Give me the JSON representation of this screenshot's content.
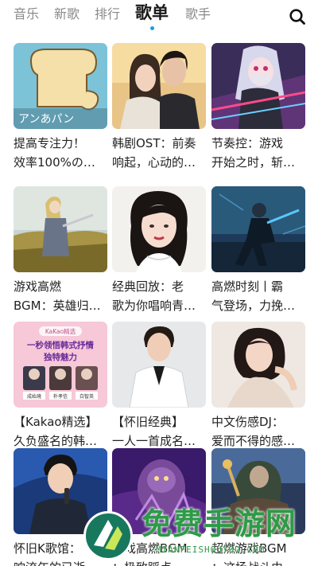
{
  "header": {
    "tabs": [
      {
        "label": "音乐",
        "active": false
      },
      {
        "label": "新歌",
        "active": false
      },
      {
        "label": "排行",
        "active": false
      },
      {
        "label": "歌单",
        "active": true
      },
      {
        "label": "歌手",
        "active": false
      }
    ],
    "search_icon": "search-icon",
    "accent_color": "#1e9de0"
  },
  "playlists": [
    {
      "title": "提高专注力！\n效率100%の…",
      "cover_text": "アンあパン"
    },
    {
      "title": "韩剧OST：前奏\n响起，心动的…"
    },
    {
      "title": "节奏控：游戏\n开始之时，斩…"
    },
    {
      "title": "游戏高燃\nBGM：英雄归…"
    },
    {
      "title": "经典回放：老\n歌为你唱响青…"
    },
    {
      "title": "高燃时刻丨霸\n气登场，力挽…"
    },
    {
      "title": "【Kakao精选】\n久负盛名的韩…",
      "cover_text": {
        "badge": "KaKao精选",
        "line1": "一秒领悟韩式抒情",
        "line2": "独特魅力",
        "names": [
          "成始璄",
          "朴孝信",
          "白智英"
        ]
      }
    },
    {
      "title": "【怀旧经典】\n一人一首成名…"
    },
    {
      "title": "中文伤感DJ：\n爱而不得的感…"
    },
    {
      "title": "怀旧K歌馆：\n响流年的已逝…"
    },
    {
      "title": "游戏高燃BGM\n：极致踩点…"
    },
    {
      "title": "超燃游戏BGM\n：这场战斗由…"
    }
  ],
  "watermark": {
    "text": "免费手游网",
    "url": "MIANFEISHOUYOU.COM"
  }
}
